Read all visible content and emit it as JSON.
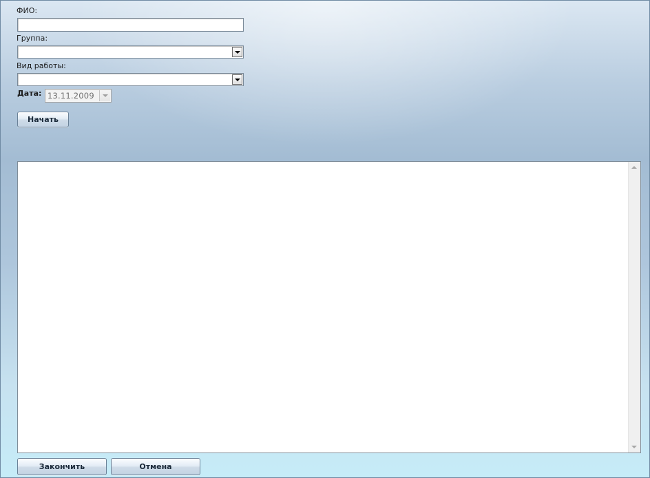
{
  "form": {
    "fio": {
      "label": "ФИО:",
      "value": ""
    },
    "group": {
      "label": "Группа:",
      "selected": "",
      "icon": "chevron-down-icon"
    },
    "work_type": {
      "label": "Вид работы:",
      "selected": "",
      "icon": "chevron-down-icon"
    },
    "date": {
      "label": "Дата:",
      "value": "13.11.2009",
      "icon": "chevron-down-icon",
      "disabled": true
    },
    "start_button": "Начать"
  },
  "log": {
    "content": ""
  },
  "footer": {
    "finish_button": "Закончить",
    "cancel_button": "Отмена"
  },
  "colors": {
    "background_top": "#dbe7f2",
    "background_mid": "#a3bcd3",
    "background_bottom": "#c6ecf8",
    "button_text": "#1b2a3a"
  }
}
